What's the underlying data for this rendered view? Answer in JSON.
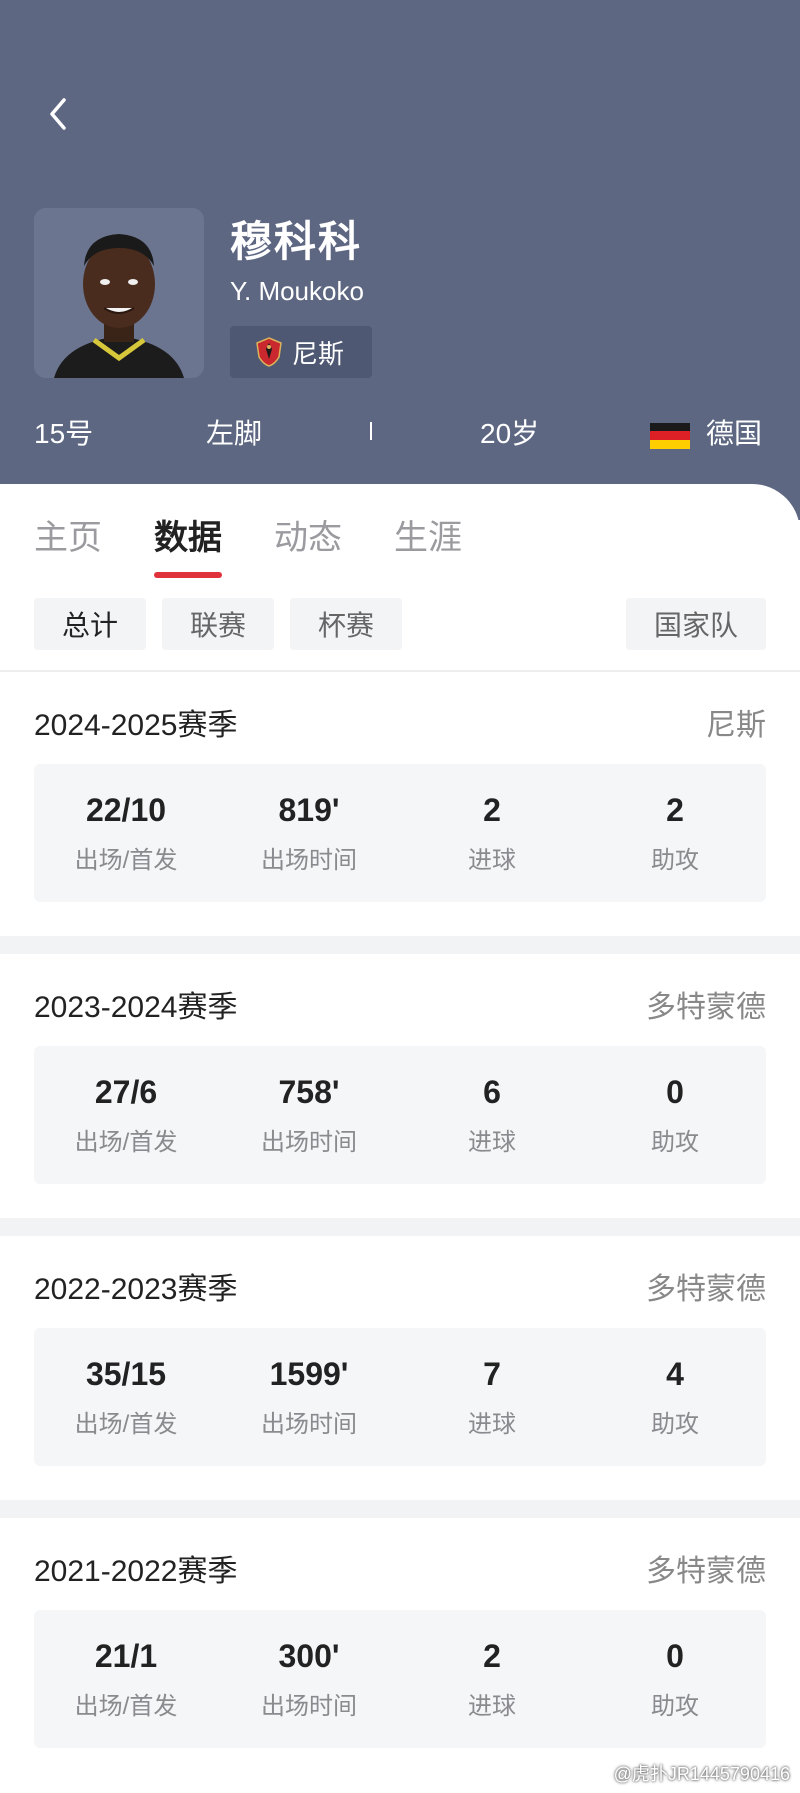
{
  "player": {
    "name": "穆科科",
    "english_name": "Y. Moukoko",
    "club": "尼斯",
    "number": "15号",
    "foot": "左脚",
    "age": "20岁",
    "nation": "德国"
  },
  "tabs": [
    {
      "label": "主页"
    },
    {
      "label": "数据"
    },
    {
      "label": "动态"
    },
    {
      "label": "生涯"
    }
  ],
  "filters": [
    {
      "label": "总计"
    },
    {
      "label": "联赛"
    },
    {
      "label": "杯赛"
    },
    {
      "label": "国家队"
    }
  ],
  "stat_labels": {
    "apps": "出场/首发",
    "minutes": "出场时间",
    "goals": "进球",
    "assists": "助攻"
  },
  "seasons": [
    {
      "title": "2024-2025赛季",
      "club": "尼斯",
      "apps": "22/10",
      "minutes": "819'",
      "goals": "2",
      "assists": "2"
    },
    {
      "title": "2023-2024赛季",
      "club": "多特蒙德",
      "apps": "27/6",
      "minutes": "758'",
      "goals": "6",
      "assists": "0"
    },
    {
      "title": "2022-2023赛季",
      "club": "多特蒙德",
      "apps": "35/15",
      "minutes": "1599'",
      "goals": "7",
      "assists": "4"
    },
    {
      "title": "2021-2022赛季",
      "club": "多特蒙德",
      "apps": "21/1",
      "minutes": "300'",
      "goals": "2",
      "assists": "0"
    }
  ],
  "watermark": "@虎扑JR1445790416",
  "colors": {
    "header_bg": "#5d6782",
    "accent": "#e0323b"
  },
  "icons": {
    "back": "chevron-left-icon",
    "club": "nice-club-crest-icon",
    "flag": "germany-flag-icon"
  }
}
